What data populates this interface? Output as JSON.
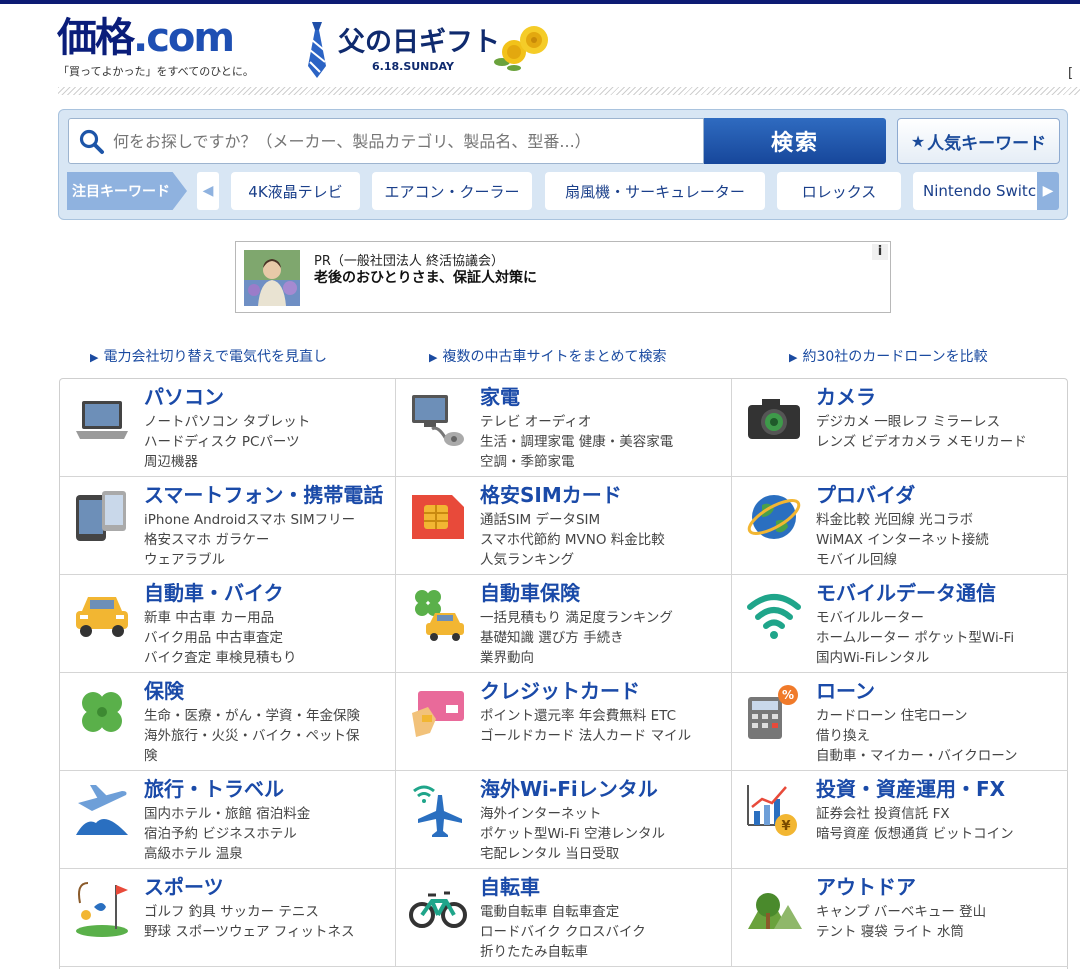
{
  "header": {
    "logo_main": "価格",
    "logo_com": ".com",
    "tagline": "「買ってよかった」をすべてのひとに。",
    "campaign_title": "父の日ギフト",
    "campaign_date": "6.18.SUNDAY",
    "corner_bracket": "["
  },
  "search": {
    "placeholder": "何をお探しですか？（メーカー、製品カテゴリ、製品名、型番...）",
    "button": "検索",
    "popular_label": "人気キーワード"
  },
  "keywords": {
    "label": "注目キーワード",
    "items": [
      "4K液晶テレビ",
      "エアコン・クーラー",
      "扇風機・サーキュレーター",
      "ロレックス",
      "Nintendo Switch Pro"
    ]
  },
  "pr": {
    "line1": "PR（一般社団法人 終活協議会）",
    "line2": "老後のおひとりさま、保証人対策に",
    "info": "i"
  },
  "toplinks": [
    "電力会社切り替えで電気代を見直し",
    "複数の中古車サイトをまとめて検索",
    "約30社のカードローンを比較"
  ],
  "categories": [
    {
      "title": "パソコン",
      "lines": [
        "ノートパソコン タブレット",
        "ハードディスク PCパーツ",
        "周辺機器"
      ],
      "icon": "laptop-icon"
    },
    {
      "title": "家電",
      "lines": [
        "テレビ オーディオ",
        "生活・調理家電 健康・美容家電",
        "空調・季節家電"
      ],
      "icon": "appliance-icon"
    },
    {
      "title": "カメラ",
      "lines": [
        "デジカメ 一眼レフ ミラーレス",
        "レンズ ビデオカメラ メモリカード"
      ],
      "icon": "camera-icon"
    },
    {
      "title": "スマートフォン・携帯電話",
      "lines": [
        "iPhone Androidスマホ SIMフリー",
        "格安スマホ ガラケー",
        "ウェアラブル"
      ],
      "icon": "smartphone-icon"
    },
    {
      "title": "格安SIMカード",
      "lines": [
        "通話SIM データSIM",
        "スマホ代節約 MVNO 料金比較",
        "人気ランキング"
      ],
      "icon": "sim-card-icon"
    },
    {
      "title": "プロバイダ",
      "lines": [
        "料金比較 光回線 光コラボ",
        "WiMAX インターネット接続",
        "モバイル回線"
      ],
      "icon": "globe-icon"
    },
    {
      "title": "自動車・バイク",
      "lines": [
        "新車 中古車 カー用品",
        "バイク用品 中古車査定",
        "バイク査定 車検見積もり"
      ],
      "icon": "car-icon"
    },
    {
      "title": "自動車保険",
      "lines": [
        "一括見積もり 満足度ランキング",
        "基礎知識 選び方 手続き",
        "業界動向"
      ],
      "icon": "car-insurance-icon"
    },
    {
      "title": "モバイルデータ通信",
      "lines": [
        "モバイルルーター",
        "ホームルーター ポケット型Wi-Fi",
        "国内Wi-Fiレンタル"
      ],
      "icon": "wifi-icon"
    },
    {
      "title": "保険",
      "lines": [
        "生命・医療・がん・学資・年金保険",
        "海外旅行・火災・バイク・ペット保",
        "険"
      ],
      "icon": "clover-icon"
    },
    {
      "title": "クレジットカード",
      "lines": [
        "ポイント還元率 年会費無料 ETC",
        "ゴールドカード 法人カード マイル"
      ],
      "icon": "credit-card-icon"
    },
    {
      "title": "ローン",
      "lines": [
        "カードローン 住宅ローン",
        "借り換え",
        "自動車・マイカー・バイクローン"
      ],
      "icon": "calculator-icon"
    },
    {
      "title": "旅行・トラベル",
      "lines": [
        "国内ホテル・旅館 宿泊料金",
        "宿泊予約 ビジネスホテル",
        "高級ホテル 温泉"
      ],
      "icon": "airplane-icon"
    },
    {
      "title": "海外Wi-Fiレンタル",
      "lines": [
        "海外インターネット",
        "ポケット型Wi-Fi 空港レンタル",
        "宅配レンタル 当日受取"
      ],
      "icon": "airplane-wifi-icon"
    },
    {
      "title": "投資・資産運用・FX",
      "lines": [
        "証券会社 投資信託 FX",
        "暗号資産 仮想通貨 ビットコイン"
      ],
      "icon": "investment-chart-icon"
    },
    {
      "title": "スポーツ",
      "lines": [
        "ゴルフ 釣具 サッカー テニス",
        "野球 スポーツウェア フィットネス"
      ],
      "icon": "sports-icon"
    },
    {
      "title": "自転車",
      "lines": [
        "電動自転車 自転車査定",
        "ロードバイク クロスバイク",
        "折りたたみ自転車"
      ],
      "icon": "bicycle-icon"
    },
    {
      "title": "アウトドア",
      "lines": [
        "キャンプ バーベキュー 登山",
        "テント 寝袋 ライト 水筒"
      ],
      "icon": "tree-icon"
    }
  ]
}
